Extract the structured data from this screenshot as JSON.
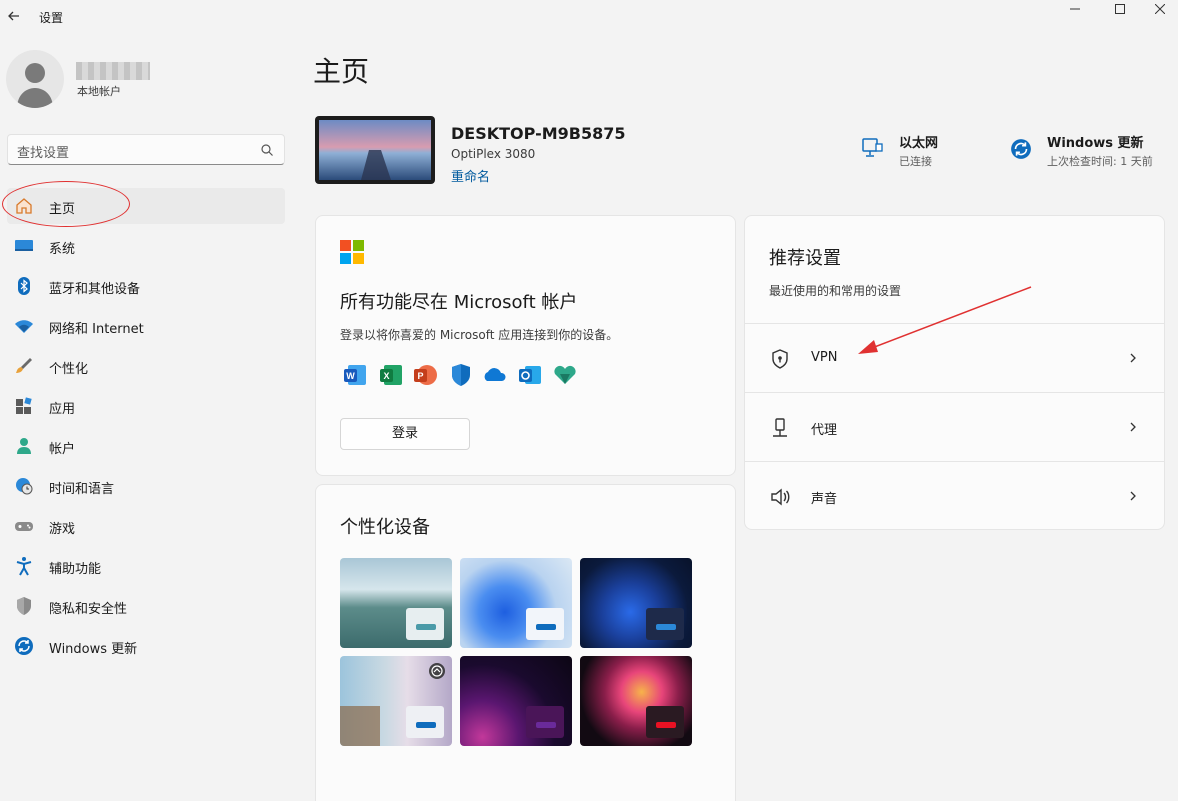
{
  "app": {
    "title": "设置"
  },
  "window_controls": {
    "minimize_icon": "minimize-icon",
    "maximize_icon": "maximize-icon",
    "close_icon": "close-icon"
  },
  "user": {
    "account_type": "本地帐户"
  },
  "search": {
    "placeholder": "查找设置"
  },
  "sidebar": {
    "items": [
      {
        "label": "主页",
        "icon": "home-icon"
      },
      {
        "label": "系统",
        "icon": "monitor-icon"
      },
      {
        "label": "蓝牙和其他设备",
        "icon": "bluetooth-icon"
      },
      {
        "label": "网络和 Internet",
        "icon": "wifi-icon"
      },
      {
        "label": "个性化",
        "icon": "brush-icon"
      },
      {
        "label": "应用",
        "icon": "apps-icon"
      },
      {
        "label": "帐户",
        "icon": "person-icon"
      },
      {
        "label": "时间和语言",
        "icon": "globe-clock-icon"
      },
      {
        "label": "游戏",
        "icon": "gamepad-icon"
      },
      {
        "label": "辅助功能",
        "icon": "accessibility-icon"
      },
      {
        "label": "隐私和安全性",
        "icon": "shield-icon"
      },
      {
        "label": "Windows 更新",
        "icon": "update-icon"
      }
    ]
  },
  "main": {
    "title": "主页",
    "device": {
      "name": "DESKTOP-M9B5875",
      "model": "OptiPlex 3080",
      "rename_link": "重命名"
    },
    "status": [
      {
        "title": "以太网",
        "subtitle": "已连接",
        "icon": "ethernet-icon"
      },
      {
        "title": "Windows 更新",
        "subtitle": "上次检查时间: 1 天前",
        "icon": "update-icon"
      }
    ],
    "ms_card": {
      "heading": "所有功能尽在 Microsoft 帐户",
      "description": "登录以将你喜爱的 Microsoft 应用连接到你的设备。",
      "apps": [
        "word-icon",
        "excel-icon",
        "powerpoint-icon",
        "defender-icon",
        "onedrive-icon",
        "outlook-icon",
        "family-icon"
      ],
      "login_button": "登录"
    },
    "personalize_card": {
      "heading": "个性化设备"
    },
    "recommended": {
      "heading": "推荐设置",
      "subtitle": "最近使用的和常用的设置",
      "items": [
        {
          "label": "VPN",
          "icon": "vpn-shield-icon"
        },
        {
          "label": "代理",
          "icon": "proxy-icon"
        },
        {
          "label": "声音",
          "icon": "speaker-icon"
        }
      ]
    }
  },
  "colors": {
    "accent": "#005a9e",
    "annotation": "#e03131"
  }
}
